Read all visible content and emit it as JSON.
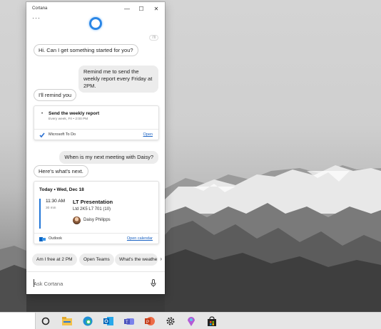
{
  "window": {
    "title": "Cortana",
    "minimize_glyph": "—",
    "maximize_glyph": "☐",
    "close_glyph": "✕",
    "more_glyph": "···",
    "history_label": "I'll"
  },
  "conversation": {
    "greeting": "Hi. Can I get something started for you?",
    "user_request_1": "Remind me to send the weekly report every Friday at 2PM.",
    "reply_1": "I'll remind you",
    "user_request_2": "When is my next meeting with Daisy?",
    "reply_2": "Here's what's next."
  },
  "reminder_card": {
    "title": "Send the weekly report",
    "schedule": "Every week, Fri • 2:00 PM",
    "app_name": "Microsoft To Do",
    "app_icon": "check-icon",
    "action_label": "Open"
  },
  "meeting_card": {
    "date_heading": "Today • Wed, Dec 18",
    "time": "11:30 AM",
    "duration": "30 min",
    "title": "LT Presentation",
    "location": "Ltd 2K5 L7 701 (10)",
    "attendee": "Daisy Philipps",
    "app_name": "Outlook",
    "app_icon": "outlook-icon",
    "action_label": "Open calendar"
  },
  "suggestions": [
    "Am I free at 2 PM",
    "Open Teams",
    "What's the weathe"
  ],
  "ask": {
    "placeholder": "Ask Cortana",
    "mic_icon": "microphone-icon"
  },
  "taskbar": {
    "icons": [
      "cortana-icon",
      "file-explorer-icon",
      "edge-icon",
      "outlook-icon",
      "teams-icon",
      "powerpoint-icon",
      "settings-icon",
      "maps-icon",
      "store-icon"
    ]
  },
  "colors": {
    "accent": "#2a86e6",
    "link": "#1a62c3",
    "taskbar": "#e6e6e6"
  }
}
